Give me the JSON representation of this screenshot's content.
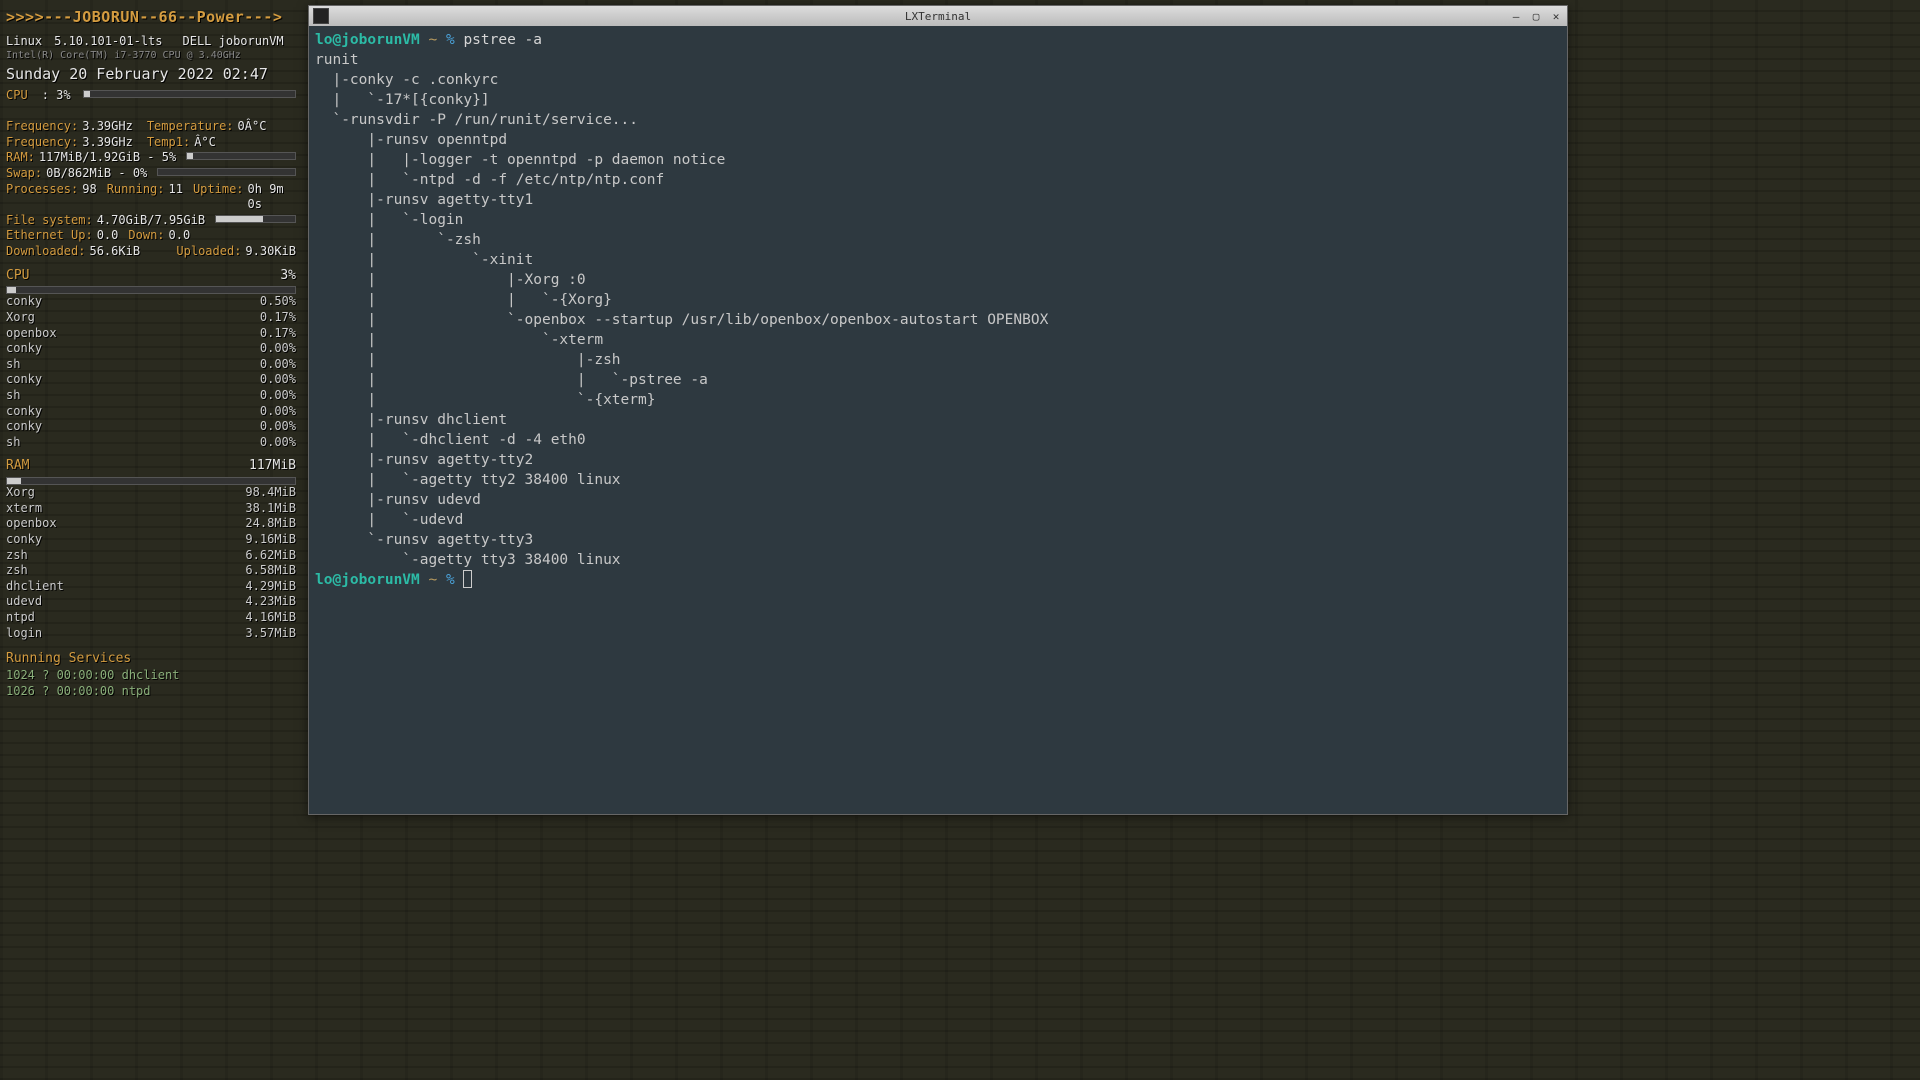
{
  "conky": {
    "header": ">>>>---JOBORUN--66--Power--->",
    "kernel_label": "Linux",
    "kernel_ver": "5.10.101-01-lts",
    "host": "DELL joborunVM",
    "cpu_model": "Intel(R) Core(TM) i7-3770 CPU @ 3.40GHz",
    "datetime": "Sunday 20 February 2022  02:47",
    "cpu_label": "CPU",
    "cpu_pct": ": 3%",
    "cpu_bar_pct": 3,
    "freq1_l": "Frequency:",
    "freq1_v": "3.39GHz",
    "temp_l": "Temperature:",
    "temp_v": "0Â°C",
    "freq2_l": "Frequency:",
    "freq2_v": "3.39GHz",
    "temp2_l": "Temp1:",
    "temp2_v": "Â°C",
    "ram_l": "RAM:",
    "ram_v": "117MiB/1.92GiB - 5%",
    "ram_bar_pct": 5,
    "swap_l": "Swap:",
    "swap_v": "0B/862MiB - 0%",
    "swap_bar_pct": 0,
    "proc_l": "Processes:",
    "proc_v": "98",
    "run_l": "Running:",
    "run_v": "11",
    "up_l": "Uptime:",
    "up_v": "0h 9m 0s",
    "fs_l": "File system:",
    "fs_v": "4.70GiB/7.95GiB",
    "fs_bar_pct": 59,
    "eth_l": "Ethernet Up:",
    "eth_up": "0.0",
    "eth_dl": "Down:",
    "eth_dn": "0.0",
    "dl_l": "Downloaded:",
    "dl_v": "56.6KiB",
    "ul_l": "Uploaded:",
    "ul_v": "9.30KiB",
    "cpu_section_l": "CPU",
    "cpu_section_v": "3%",
    "cpu_procs": [
      {
        "name": "conky",
        "pct": "0.50%"
      },
      {
        "name": "Xorg",
        "pct": "0.17%"
      },
      {
        "name": "openbox",
        "pct": "0.17%"
      },
      {
        "name": "conky",
        "pct": "0.00%"
      },
      {
        "name": "sh",
        "pct": "0.00%"
      },
      {
        "name": "conky",
        "pct": "0.00%"
      },
      {
        "name": "sh",
        "pct": "0.00%"
      },
      {
        "name": "conky",
        "pct": "0.00%"
      },
      {
        "name": "conky",
        "pct": "0.00%"
      },
      {
        "name": "sh",
        "pct": "0.00%"
      }
    ],
    "ram_section_l": "RAM",
    "ram_section_v": "117MiB",
    "ram_procs": [
      {
        "name": "Xorg",
        "v": "98.4MiB"
      },
      {
        "name": "xterm",
        "v": "38.1MiB"
      },
      {
        "name": "openbox",
        "v": "24.8MiB"
      },
      {
        "name": "conky",
        "v": "9.16MiB"
      },
      {
        "name": "zsh",
        "v": "6.62MiB"
      },
      {
        "name": "zsh",
        "v": "6.58MiB"
      },
      {
        "name": "dhclient",
        "v": "4.29MiB"
      },
      {
        "name": "udevd",
        "v": "4.23MiB"
      },
      {
        "name": "ntpd",
        "v": "4.16MiB"
      },
      {
        "name": "login",
        "v": "3.57MiB"
      }
    ],
    "svc_header": "Running Services",
    "svcs": [
      " 1024 ?        00:00:00 dhclient",
      " 1026 ?        00:00:00 ntpd"
    ]
  },
  "terminal": {
    "title": "LXTerminal",
    "prompt_user": "lo@joborunVM",
    "prompt_tilde": "~",
    "prompt_pct": "%",
    "cmd": "pstree -a",
    "output": "runit\n  |-conky -c .conkyrc\n  |   `-17*[{conky}]\n  `-runsvdir -P /run/runit/service...\n      |-runsv openntpd\n      |   |-logger -t openntpd -p daemon notice\n      |   `-ntpd -d -f /etc/ntp/ntp.conf\n      |-runsv agetty-tty1\n      |   `-login\n      |       `-zsh\n      |           `-xinit\n      |               |-Xorg :0\n      |               |   `-{Xorg}\n      |               `-openbox --startup /usr/lib/openbox/openbox-autostart OPENBOX\n      |                   `-xterm\n      |                       |-zsh\n      |                       |   `-pstree -a\n      |                       `-{xterm}\n      |-runsv dhclient\n      |   `-dhclient -d -4 eth0\n      |-runsv agetty-tty2\n      |   `-agetty tty2 38400 linux\n      |-runsv udevd\n      |   `-udevd\n      `-runsv agetty-tty3\n          `-agetty tty3 38400 linux"
  }
}
